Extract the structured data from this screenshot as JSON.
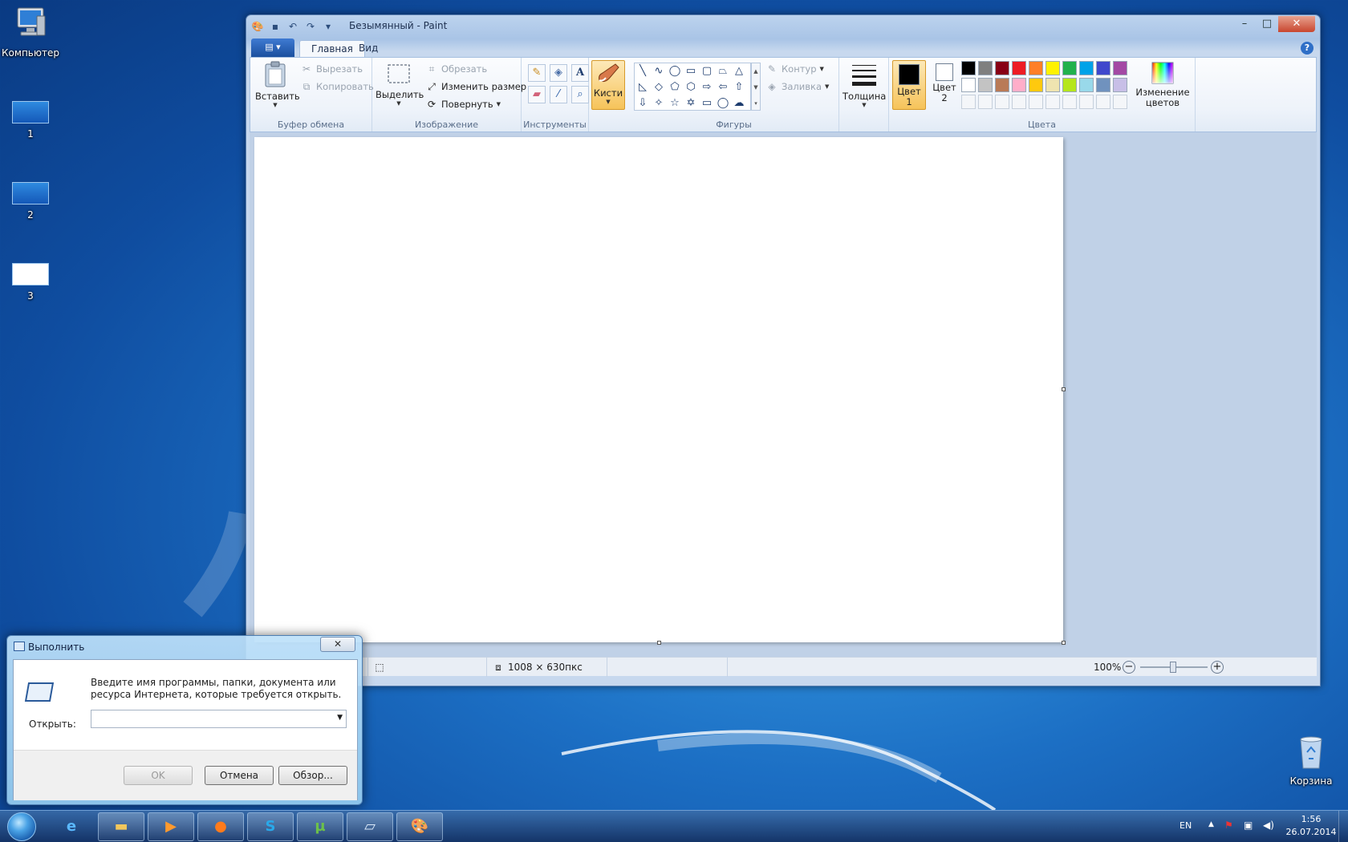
{
  "desktop": {
    "computer_label": "Компьютер",
    "item1_label": "1",
    "item2_label": "2",
    "item3_label": "3",
    "recycle_label": "Корзина"
  },
  "paint": {
    "title": "Безымянный - Paint",
    "tabs": {
      "home": "Главная",
      "view": "Вид"
    },
    "clipboard": {
      "paste": "Вставить",
      "cut": "Вырезать",
      "copy": "Копировать",
      "group": "Буфер обмена"
    },
    "image": {
      "select": "Выделить",
      "crop": "Обрезать",
      "resize": "Изменить размер",
      "rotate": "Повернуть",
      "group": "Изображение"
    },
    "tools": {
      "group": "Инструменты"
    },
    "brushes": {
      "label": "Кисти"
    },
    "shapes": {
      "outline": "Контур",
      "fill": "Заливка",
      "group": "Фигуры"
    },
    "size": {
      "label": "Толщина"
    },
    "colors": {
      "color1_line1": "Цвет",
      "color1_line2": "1",
      "color2_line1": "Цвет",
      "color2_line2": "2",
      "edit_line1": "Изменение",
      "edit_line2": "цветов",
      "group": "Цвета",
      "color1_value": "#000000",
      "color2_value": "#ffffff",
      "palette": [
        "#000000",
        "#7f7f7f",
        "#880015",
        "#ed1c24",
        "#ff7f27",
        "#fff200",
        "#22b14c",
        "#00a2e8",
        "#3f48cc",
        "#a349a4",
        "#ffffff",
        "#c3c3c3",
        "#b97a57",
        "#ffaec9",
        "#ffc90e",
        "#efe4b0",
        "#b5e61d",
        "#99d9ea",
        "#7092be",
        "#c8bfe7"
      ]
    },
    "status": {
      "dimensions": "1008 × 630пкс",
      "zoom": "100%"
    }
  },
  "run_dialog": {
    "title": "Выполнить",
    "description": "Введите имя программы, папки, документа или ресурса Интернета, которые требуется открыть.",
    "open_label": "Открыть:",
    "open_value": "",
    "ok": "OK",
    "cancel": "Отмена",
    "browse": "Обзор..."
  },
  "taskbar": {
    "lang": "EN",
    "time": "1:56",
    "date": "26.07.2014"
  }
}
